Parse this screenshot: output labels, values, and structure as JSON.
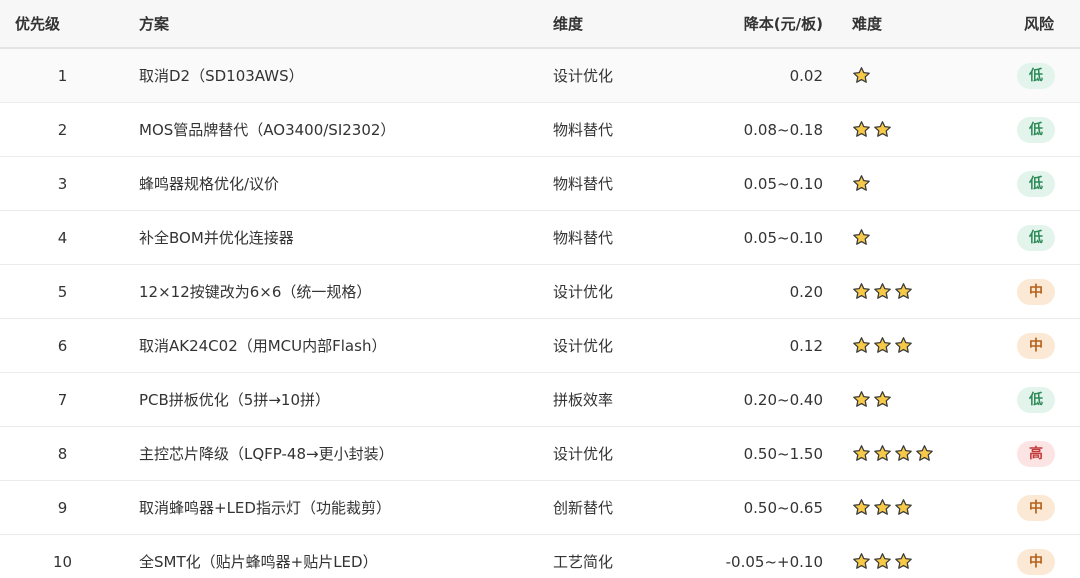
{
  "headers": {
    "priority": "优先级",
    "plan": "方案",
    "dimension": "维度",
    "cost_reduction": "降本(元/板)",
    "difficulty": "难度",
    "risk": "风险"
  },
  "colors": {
    "risk_low_bg": "#e3f4ec",
    "risk_low_text": "#2e8b57",
    "risk_mid_bg": "#fbe9d5",
    "risk_mid_text": "#b5621b",
    "risk_high_bg": "#fce4e4",
    "risk_high_text": "#c23b3b",
    "star_fill": "#f7c948",
    "star_stroke": "#3a3a3a"
  },
  "rows": [
    {
      "priority": "1",
      "plan": "取消D2（SD103AWS）",
      "dimension": "设计优化",
      "cost": "0.02",
      "difficulty": 1,
      "risk": "低",
      "risk_level": "low"
    },
    {
      "priority": "2",
      "plan": "MOS管品牌替代（AO3400/SI2302）",
      "dimension": "物料替代",
      "cost": "0.08~0.18",
      "difficulty": 2,
      "risk": "低",
      "risk_level": "low"
    },
    {
      "priority": "3",
      "plan": "蜂鸣器规格优化/议价",
      "dimension": "物料替代",
      "cost": "0.05~0.10",
      "difficulty": 1,
      "risk": "低",
      "risk_level": "low"
    },
    {
      "priority": "4",
      "plan": "补全BOM并优化连接器",
      "dimension": "物料替代",
      "cost": "0.05~0.10",
      "difficulty": 1,
      "risk": "低",
      "risk_level": "low"
    },
    {
      "priority": "5",
      "plan": "12×12按键改为6×6（统一规格）",
      "dimension": "设计优化",
      "cost": "0.20",
      "difficulty": 3,
      "risk": "中",
      "risk_level": "mid"
    },
    {
      "priority": "6",
      "plan": "取消AK24C02（用MCU内部Flash）",
      "dimension": "设计优化",
      "cost": "0.12",
      "difficulty": 3,
      "risk": "中",
      "risk_level": "mid"
    },
    {
      "priority": "7",
      "plan": "PCB拼板优化（5拼→10拼）",
      "dimension": "拼板效率",
      "cost": "0.20~0.40",
      "difficulty": 2,
      "risk": "低",
      "risk_level": "low"
    },
    {
      "priority": "8",
      "plan": "主控芯片降级（LQFP-48→更小封装）",
      "dimension": "设计优化",
      "cost": "0.50~1.50",
      "difficulty": 4,
      "risk": "高",
      "risk_level": "high"
    },
    {
      "priority": "9",
      "plan": "取消蜂鸣器+LED指示灯（功能裁剪）",
      "dimension": "创新替代",
      "cost": "0.50~0.65",
      "difficulty": 3,
      "risk": "中",
      "risk_level": "mid"
    },
    {
      "priority": "10",
      "plan": "全SMT化（贴片蜂鸣器+贴片LED）",
      "dimension": "工艺简化",
      "cost": "-0.05~+0.10",
      "difficulty": 3,
      "risk": "中",
      "risk_level": "mid"
    }
  ]
}
